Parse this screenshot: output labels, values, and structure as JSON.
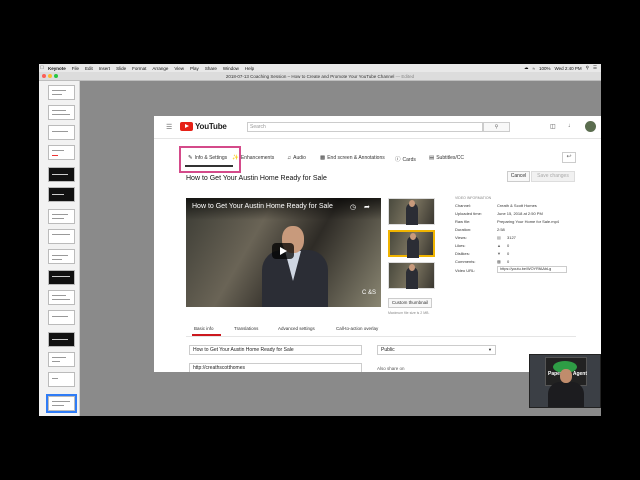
{
  "menubar": {
    "app": "Keynote",
    "items": [
      "File",
      "Edit",
      "Insert",
      "Slide",
      "Format",
      "Arrange",
      "View",
      "Play",
      "Share",
      "Window",
      "Help"
    ],
    "status": "100%",
    "clock": "Wed 2:40 PM"
  },
  "window": {
    "title": "2018-07-13 Coaching Session – How to Create and Promote Your YouTube Channel",
    "edited": "— Edited"
  },
  "youtube": {
    "wordmark": "YouTube",
    "search_placeholder": "Search",
    "tabs": [
      {
        "label": "Info & Settings",
        "icon": "pencil-icon"
      },
      {
        "label": "Enhancements",
        "icon": "wand-icon"
      },
      {
        "label": "Audio",
        "icon": "music-icon"
      },
      {
        "label": "End screen & Annotations",
        "icon": "endscreen-icon"
      },
      {
        "label": "Cards",
        "icon": "info-icon"
      },
      {
        "label": "Subtitles/CC",
        "icon": "cc-icon"
      }
    ],
    "video_title": "How to Get Your Austin Home Ready for Sale",
    "player_title": "How to Get Your Austin Home Ready for Sale",
    "player_brand": "C\n&S",
    "cancel_label": "Cancel",
    "save_label": "Save changes",
    "custom_thumbnail": "Custom thumbnail",
    "max_size": "Maximum file size is 2 MB.",
    "info": {
      "header": "VIDEO INFORMATION",
      "channel_label": "Channel:",
      "channel": "Creath & Scott Homes",
      "uploaded_label": "Uploaded time:",
      "uploaded": "June 15, 2018 at 2:50 PM",
      "rawfile_label": "Raw file:",
      "rawfile": "Preparing Your Home for Sale.mp4",
      "duration_label": "Duration:",
      "duration": "2:58",
      "views_label": "Views:",
      "views": "3127",
      "likes_label": "Likes:",
      "likes": "0",
      "dislikes_label": "Dislikes:",
      "dislikes": "0",
      "comments_label": "Comments:",
      "comments": "0",
      "url_label": "Video URL:",
      "url": "https://youtu.be/WOYRfAAbLg"
    },
    "subtabs": [
      "Basic info",
      "Translations",
      "Advanced settings",
      "Call-to-action overlay"
    ],
    "title_field": "How to Get Your Austin Home Ready for Sale",
    "privacy": "Public",
    "desc_field": "http://creathscotthomes",
    "also_share": "Also share on"
  },
  "webcam_sign": "Paperless Agent",
  "colors": {
    "youtube_red": "#e62117",
    "highlight": "#d44a8a",
    "selection_blue": "#2f7cf6"
  }
}
